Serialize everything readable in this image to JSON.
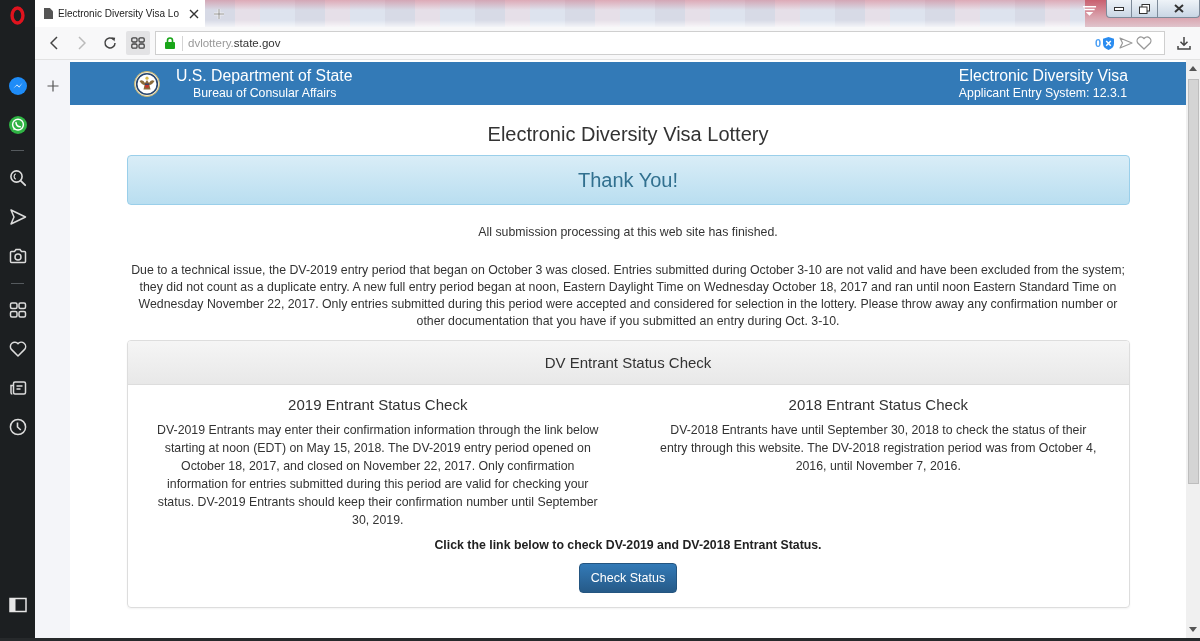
{
  "browser": {
    "tabs": [
      {
        "title": "Electronic Diversity Visa Lo",
        "selected": true
      }
    ],
    "back_disabled": false,
    "forward_disabled": true,
    "address": {
      "subdomain": "dvlottery.",
      "domain": "state.gov"
    },
    "adblock_count": "0"
  },
  "header": {
    "agency": "U.S. Department of State",
    "bureau": "Bureau of Consular Affairs",
    "system": "Electronic Diversity Visa",
    "version": "Applicant Entry System: 12.3.1"
  },
  "page": {
    "title": "Electronic Diversity Visa Lottery",
    "alert": "Thank You!",
    "notice": "All submission processing at this web site has finished.",
    "paragraph": "Due to a technical issue, the DV-2019 entry period that began on October 3 was closed. Entries submitted during October 3-10 are not valid and have been excluded from the system; they did not count as a duplicate entry. A new full entry period began at noon, Eastern Daylight Time on Wednesday October 18, 2017 and ran until noon Eastern Standard Time on Wednesday November 22, 2017. Only entries submitted during this period were accepted and considered for selection in the lottery. Please throw away any confirmation number or other documentation that you have if you submitted an entry during Oct. 3-10.",
    "panel": {
      "heading": "DV Entrant Status Check",
      "columns": [
        {
          "title": "2019 Entrant Status Check",
          "text": "DV-2019 Entrants may enter their confirmation information through the link below starting at noon (EDT) on May 15, 2018. The DV-2019 entry period opened on October 18, 2017, and closed on November 22, 2017. Only confirmation information for entries submitted during this period are valid for checking your status. DV-2019 Entrants should keep their confirmation number until September 30, 2019."
        },
        {
          "title": "2018 Entrant Status Check",
          "text": "DV-2018 Entrants have until September 30, 2018 to check the status of their entry through this website. The DV-2018 registration period was from October 4, 2016, until November 7, 2016."
        }
      ],
      "instruction": "Click the link below to check DV-2019 and DV-2018 Entrant Status.",
      "button": "Check Status"
    }
  }
}
